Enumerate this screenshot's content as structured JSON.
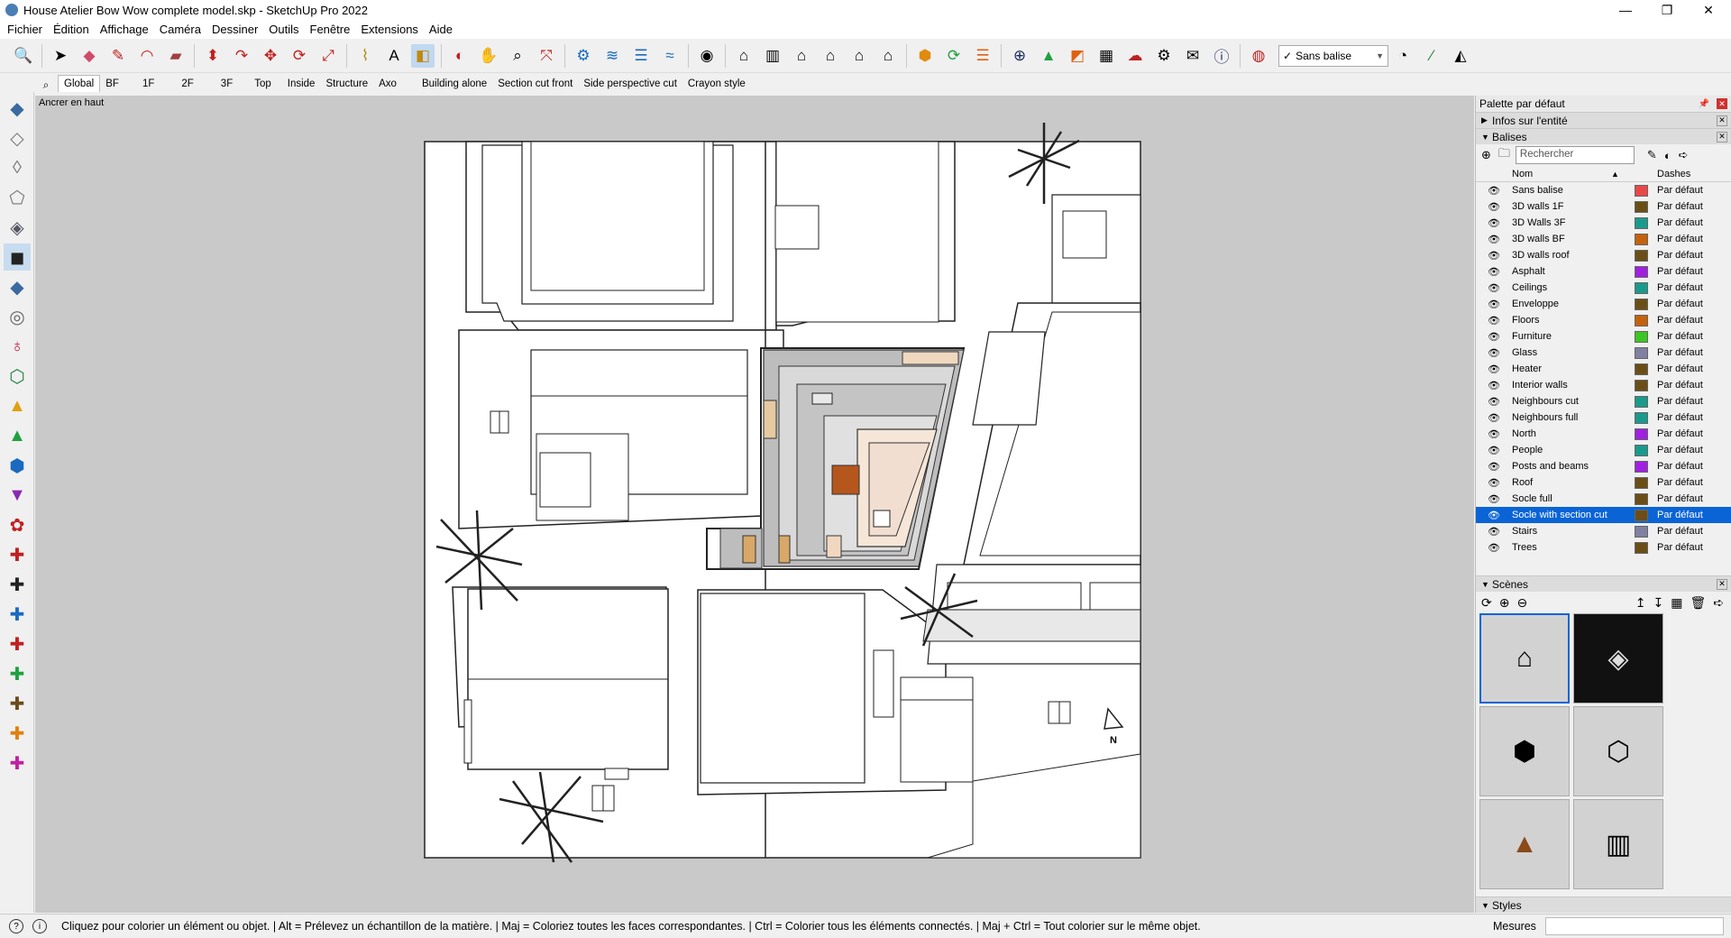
{
  "window": {
    "title": "House Atelier Bow Wow complete model.skp - SketchUp Pro 2022",
    "minimize": "—",
    "restore": "❐",
    "close": "✕"
  },
  "menu": [
    "Fichier",
    "Édition",
    "Affichage",
    "Caméra",
    "Dessiner",
    "Outils",
    "Fenêtre",
    "Extensions",
    "Aide"
  ],
  "toolbar": {
    "icons": [
      "search-icon",
      "select-icon",
      "eraser-icon",
      "pencil-icon",
      "shape-icon",
      "paint-icon",
      "push-pull-icon",
      "follow-me-icon",
      "move-icon",
      "rotate-icon",
      "scale-icon",
      "tape-icon",
      "text-icon",
      "paint-bucket-icon",
      "orbit-icon",
      "pan-icon",
      "zoom-icon",
      "zoom-extents-icon",
      "section-icon",
      "layers-icon",
      "sandbox-icon",
      "user-icon",
      "house-icon",
      "extension-icon",
      "sync-icon",
      "plus-icon",
      "tree-icon",
      "checker-icon",
      "cloud-icon",
      "gear-icon",
      "mail-icon",
      "info-icon"
    ],
    "tag_select_value": "Sans balise"
  },
  "scenes_tabs": [
    "Global",
    "BF",
    "1F",
    "2F",
    "3F",
    "Top",
    "Inside",
    "Structure",
    "Axo",
    "Building alone",
    "Section cut front",
    "Side perspective cut",
    "Crayon style"
  ],
  "viewport": {
    "label": "Ancrer en haut",
    "north": "N"
  },
  "tray": {
    "title": "Palette par défaut",
    "entity_info": "Infos sur l'entité",
    "tags_panel": "Balises",
    "search_placeholder": "Rechercher",
    "col_name": "Nom",
    "col_dashes": "Dashes",
    "tags": [
      {
        "name": "Sans balise",
        "color": "#e8474a",
        "dash": "Par défaut"
      },
      {
        "name": "3D walls 1F",
        "color": "#6b4e16",
        "dash": "Par défaut"
      },
      {
        "name": "3D Walls 3F",
        "color": "#1a9a8c",
        "dash": "Par défaut"
      },
      {
        "name": "3D walls BF",
        "color": "#c4620e",
        "dash": "Par défaut"
      },
      {
        "name": "3D walls roof",
        "color": "#6b4e16",
        "dash": "Par défaut"
      },
      {
        "name": "Asphalt",
        "color": "#a020e0",
        "dash": "Par défaut"
      },
      {
        "name": "Ceilings",
        "color": "#1a9a8c",
        "dash": "Par défaut"
      },
      {
        "name": "Enveloppe",
        "color": "#6b4e16",
        "dash": "Par défaut"
      },
      {
        "name": "Floors",
        "color": "#c4620e",
        "dash": "Par défaut"
      },
      {
        "name": "Furniture",
        "color": "#3ec424",
        "dash": "Par défaut"
      },
      {
        "name": "Glass",
        "color": "#8080a0",
        "dash": "Par défaut"
      },
      {
        "name": "Heater",
        "color": "#6b4e16",
        "dash": "Par défaut"
      },
      {
        "name": "Interior walls",
        "color": "#6b4e16",
        "dash": "Par défaut"
      },
      {
        "name": "Neighbours cut",
        "color": "#1a9a8c",
        "dash": "Par défaut"
      },
      {
        "name": "Neighbours full",
        "color": "#1a9a8c",
        "dash": "Par défaut"
      },
      {
        "name": "North",
        "color": "#a020e0",
        "dash": "Par défaut"
      },
      {
        "name": "People",
        "color": "#1a9a8c",
        "dash": "Par défaut"
      },
      {
        "name": "Posts and beams",
        "color": "#a020e0",
        "dash": "Par défaut"
      },
      {
        "name": "Roof",
        "color": "#6b4e16",
        "dash": "Par défaut"
      },
      {
        "name": "Socle full",
        "color": "#6b4e16",
        "dash": "Par défaut"
      },
      {
        "name": "Socle with section cut",
        "color": "#6b4e16",
        "dash": "Par défaut",
        "selected": true
      },
      {
        "name": "Stairs",
        "color": "#8080a0",
        "dash": "Par défaut"
      },
      {
        "name": "Trees",
        "color": "#6b4e16",
        "dash": "Par défaut"
      }
    ],
    "scenes_panel": "Scènes",
    "styles_panel": "Styles"
  },
  "status": {
    "message": "Cliquez pour colorier un élément ou objet. | Alt = Prélevez un échantillon de la matière. | Maj = Coloriez toutes les faces correspondantes. | Ctrl = Colorier tous les éléments connectés. | Maj + Ctrl = Tout colorier sur le même objet.",
    "measure_label": "Mesures"
  }
}
